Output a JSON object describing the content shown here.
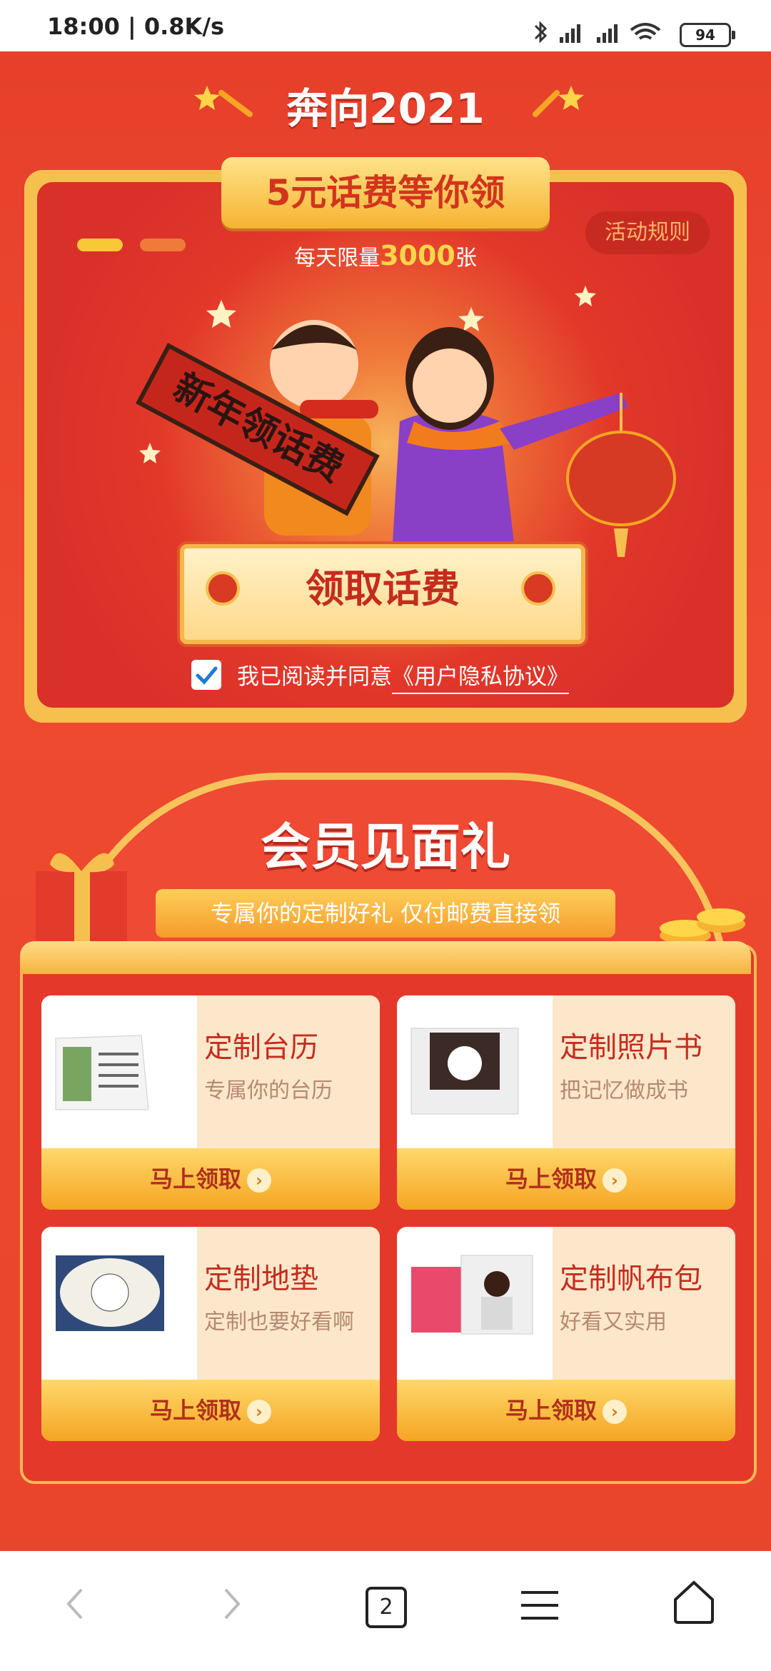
{
  "status_bar": {
    "time": "18:00",
    "speed": "0.8K/s",
    "battery": "94"
  },
  "header": {
    "title": "奔向2021"
  },
  "promo": {
    "banner": "5元话费等你领",
    "rules_button": "活动规则",
    "daily_limit_prefix": "每天限量",
    "daily_limit_count": "3000",
    "daily_limit_suffix": "张",
    "scroll_text": "新年领话费",
    "claim_button": "领取话费",
    "agree_text": "我已阅读并同意",
    "agree_link": "《用户隐私协议》"
  },
  "member": {
    "title": "会员见面礼",
    "subtitle": "专属你的定制好礼 仅付邮费直接领",
    "items": [
      {
        "title": "定制台历",
        "desc": "专属你的台历",
        "button": "马上领取"
      },
      {
        "title": "定制照片书",
        "desc": "把记忆做成书",
        "button": "马上领取"
      },
      {
        "title": "定制地垫",
        "desc": "定制也要好看啊",
        "button": "马上领取"
      },
      {
        "title": "定制帆布包",
        "desc": "好看又实用",
        "button": "马上领取"
      }
    ]
  },
  "bottom_nav": {
    "tabs_count": "2"
  },
  "colors": {
    "page_bg": "#e8402a",
    "accent_gold": "#f6c04f",
    "text_red": "#c62c1e"
  }
}
